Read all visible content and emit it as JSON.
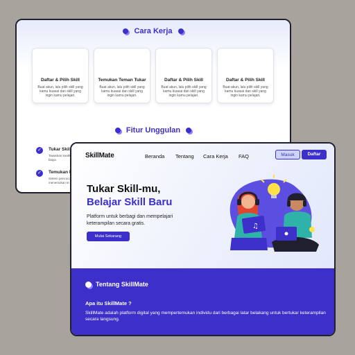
{
  "back": {
    "section1_title": "Cara Kerja",
    "cards": [
      {
        "title": "Daftar & Pilih Skill",
        "desc": "Buat akun, lalu pilih skill yang kamu kuasai dan skill yang ingin kamu pelajari."
      },
      {
        "title": "Temukan Teman Tukar",
        "desc": "Buat akun, lalu pilih skill yang kamu kuasai dan skill yang ingin kamu pelajari."
      },
      {
        "title": "Daftar & Pilih Skill",
        "desc": "Buat akun, lalu pilih skill yang kamu kuasai dan skill yang ingin kamu pelajari."
      },
      {
        "title": "Daftar & Pilih Skill",
        "desc": "Buat akun, lalu pilih skill yang kamu kuasai dan skill yang ingin kamu pelajari."
      }
    ],
    "section2_title": "Fitur Unggulan",
    "features": [
      {
        "title": "Tukar Skil",
        "desc": "Tawarkan keahlianmu tanpa biaya"
      },
      {
        "title": "Temukan P",
        "desc": "Sistem pencocokan untuk menemukan te"
      }
    ]
  },
  "front": {
    "logo": "SkillMate",
    "nav": [
      "Beranda",
      "Tentang",
      "Cara Kerja",
      "FAQ"
    ],
    "btn_login": "Masuk",
    "btn_register": "Daftar",
    "hero_line1": "Tukar Skill-mu,",
    "hero_line2": "Belajar Skill Baru",
    "hero_sub": "Platform untuk berbagi dan mempelajari keterampilan secara gratis.",
    "cta": "Mulai Sekarang",
    "about_title": "Tentang SkillMate",
    "about_question": "Apa itu SkillMate ?",
    "about_text": "SkillMate adalah platform digital yang mempertemukan individu dari berbagai latar belakang untuk bertukar keterampilan secara langsung."
  },
  "colors": {
    "accent": "#3d2fc9",
    "background": "#a8a39c"
  }
}
